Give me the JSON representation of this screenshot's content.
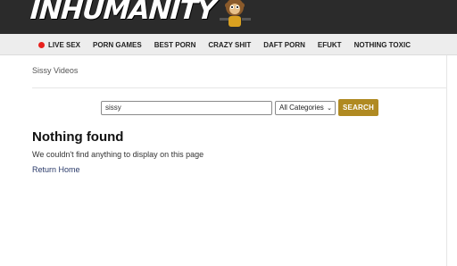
{
  "header": {
    "logo_text": "INHUMANITY"
  },
  "nav": {
    "items": [
      {
        "label": "LIVE SEX",
        "live": true
      },
      {
        "label": "PORN GAMES"
      },
      {
        "label": "BEST PORN"
      },
      {
        "label": "CRAZY SHIT"
      },
      {
        "label": "DAFT PORN"
      },
      {
        "label": "EFUKT"
      },
      {
        "label": "NOTHING TOXIC"
      }
    ],
    "live_dot_color": "#e8201c"
  },
  "breadcrumb": "Sissy Videos",
  "search": {
    "value": "sissy",
    "category_selected": "All Categories",
    "button_label": "SEARCH",
    "button_color": "#b08a22"
  },
  "result": {
    "heading": "Nothing found",
    "message": "We couldn't find anything to display on this page",
    "return_link": "Return Home"
  }
}
